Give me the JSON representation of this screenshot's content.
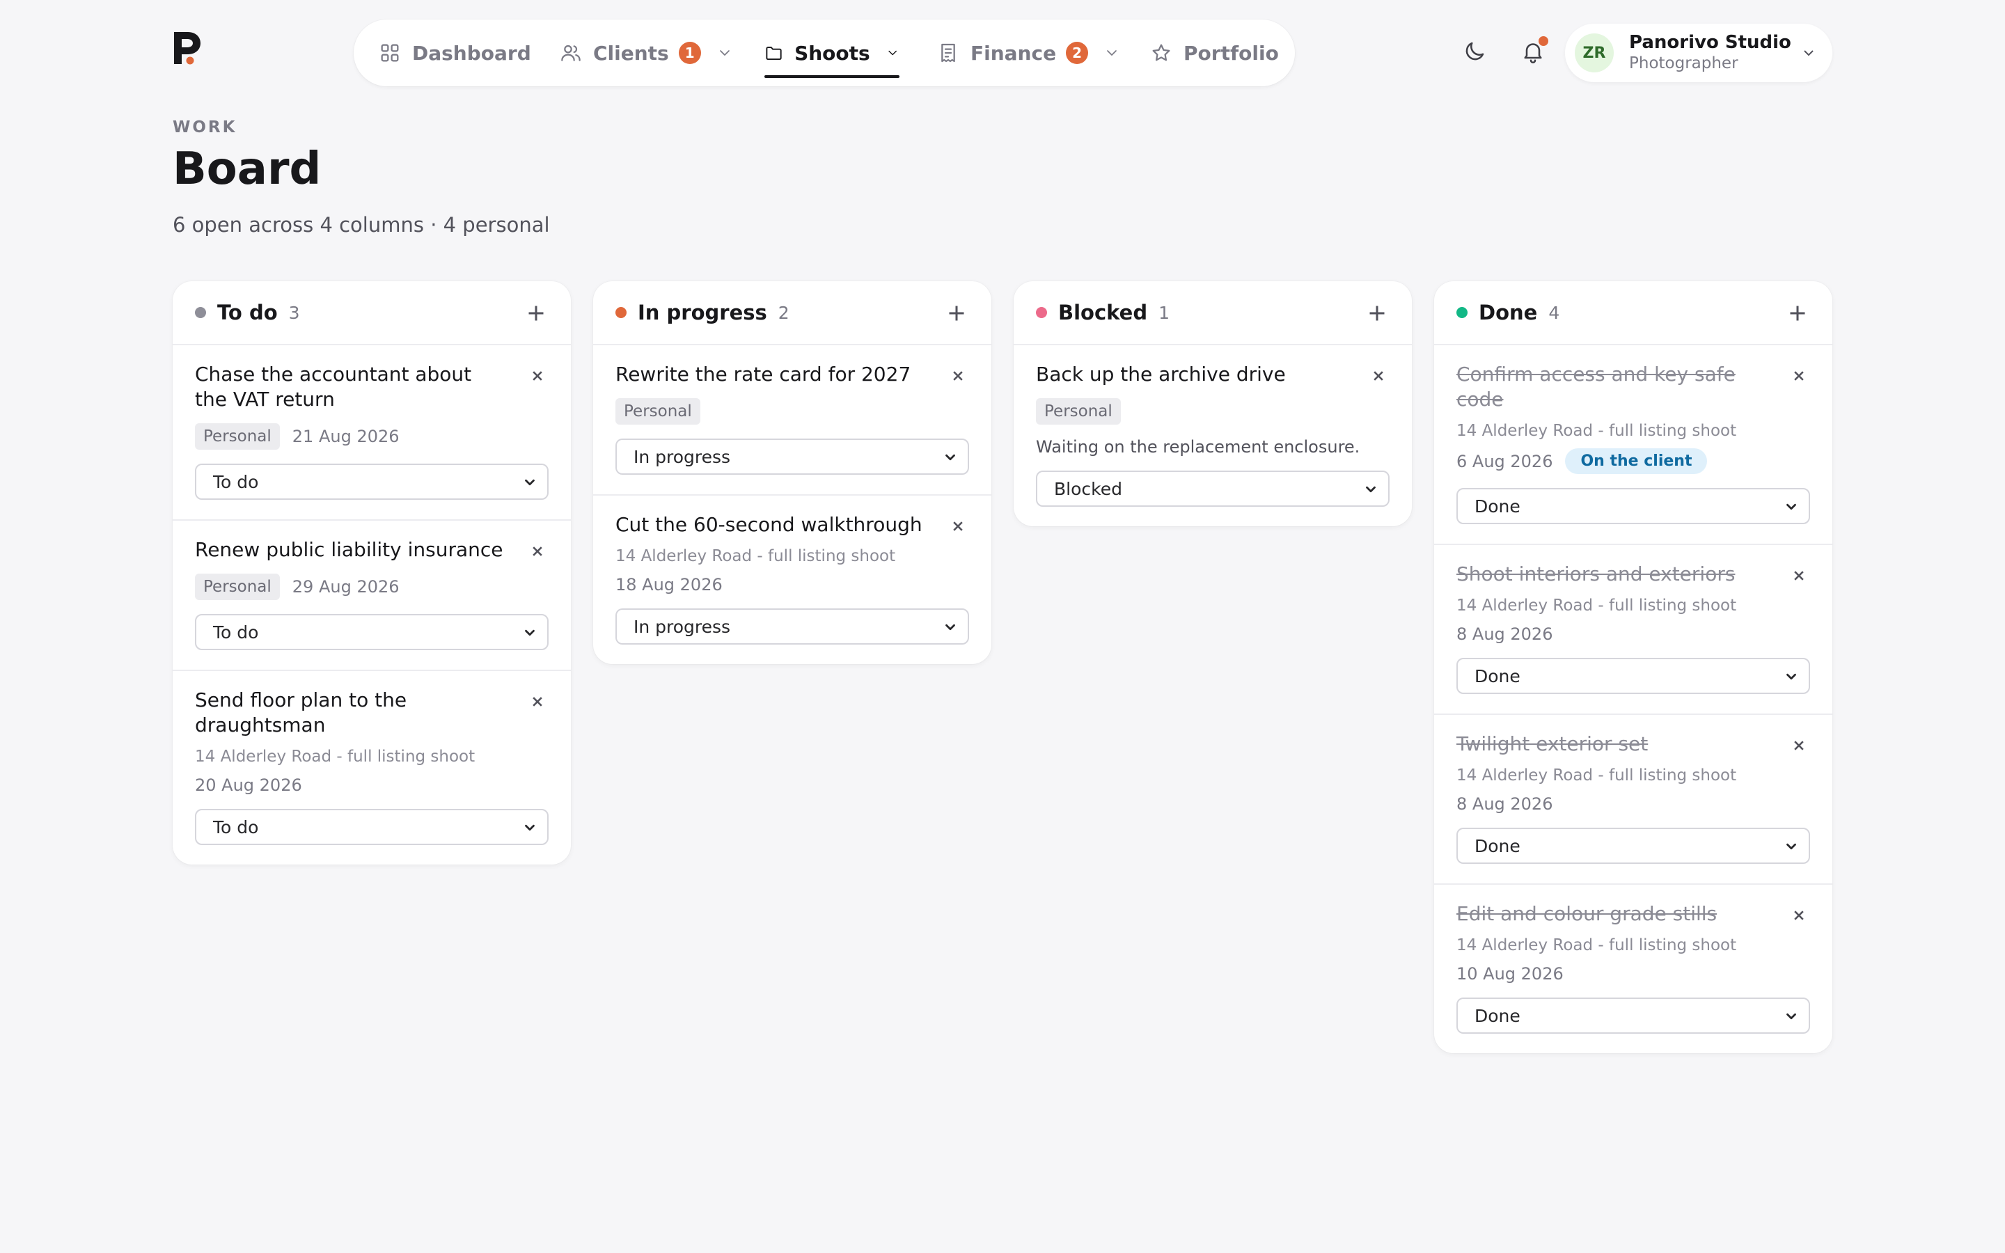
{
  "nav": {
    "items": [
      {
        "label": "Dashboard",
        "icon": "grid-icon"
      },
      {
        "label": "Clients",
        "icon": "users-icon",
        "badge": "1"
      },
      {
        "label": "Shoots",
        "icon": "folder-icon",
        "active": true
      },
      {
        "label": "Finance",
        "icon": "receipt-icon",
        "badge": "2"
      },
      {
        "label": "Portfolio",
        "icon": "star-icon"
      }
    ]
  },
  "account": {
    "initials": "ZR",
    "name": "Panorivo Studio",
    "role": "Photographer"
  },
  "header": {
    "eyebrow": "WORK",
    "title": "Board",
    "subtitle": "6 open across 4 columns · 4 personal"
  },
  "colors": {
    "accent": "#e0683a",
    "todo": "#8e8e98",
    "in_progress": "#e0683a",
    "blocked": "#ec6a8a",
    "done": "#12b886"
  },
  "columns": [
    {
      "title": "To do",
      "count": "3",
      "cards": [
        {
          "title": "Chase the accountant about the VAT return",
          "chip": "Personal",
          "date": "21 Aug 2026",
          "status": "To do"
        },
        {
          "title": "Renew public liability insurance",
          "chip": "Personal",
          "date": "29 Aug 2026",
          "status": "To do"
        },
        {
          "title": "Send floor plan to the draughtsman",
          "shoot": "14 Alderley Road - full listing shoot",
          "date": "20 Aug 2026",
          "status": "To do"
        }
      ]
    },
    {
      "title": "In progress",
      "count": "2",
      "cards": [
        {
          "title": "Rewrite the rate card for 2027",
          "chip": "Personal",
          "status": "In progress"
        },
        {
          "title": "Cut the 60-second walkthrough",
          "shoot": "14 Alderley Road - full listing shoot",
          "date": "18 Aug 2026",
          "status": "In progress"
        }
      ]
    },
    {
      "title": "Blocked",
      "count": "1",
      "cards": [
        {
          "title": "Back up the archive drive",
          "chip": "Personal",
          "note": "Waiting on the replacement enclosure.",
          "status": "Blocked"
        }
      ]
    },
    {
      "title": "Done",
      "count": "4",
      "cards": [
        {
          "title": "Confirm access and key safe code",
          "shoot": "14 Alderley Road - full listing shoot",
          "date": "6 Aug 2026",
          "pill": "On the client",
          "status": "Done"
        },
        {
          "title": "Shoot interiors and exteriors",
          "shoot": "14 Alderley Road - full listing shoot",
          "date": "8 Aug 2026",
          "status": "Done"
        },
        {
          "title": "Twilight exterior set",
          "shoot": "14 Alderley Road - full listing shoot",
          "date": "8 Aug 2026",
          "status": "Done"
        },
        {
          "title": "Edit and colour grade stills",
          "shoot": "14 Alderley Road - full listing shoot",
          "date": "10 Aug 2026",
          "status": "Done"
        }
      ]
    }
  ]
}
